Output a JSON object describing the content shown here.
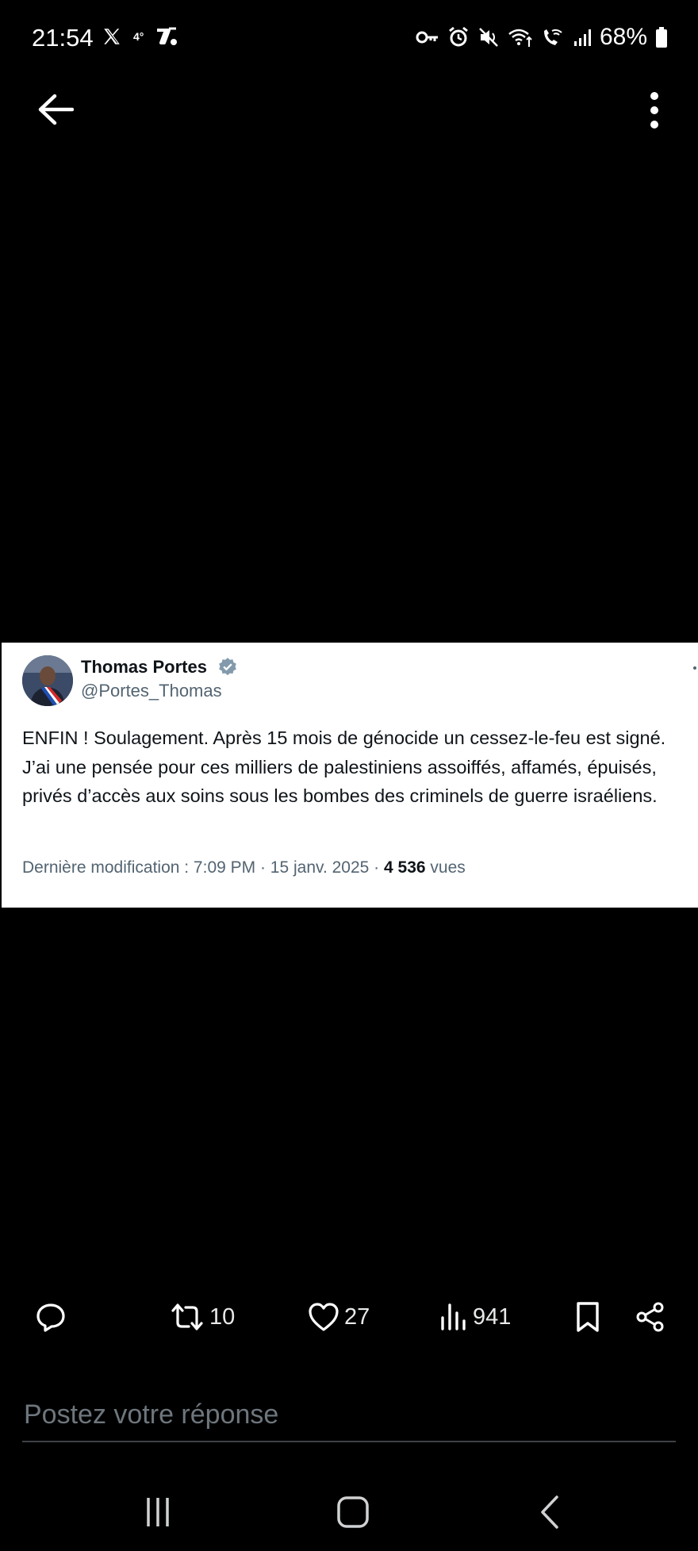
{
  "status_bar": {
    "time": "21:54",
    "temperature": "4°",
    "battery": "68%",
    "icons": [
      "x-logo-icon",
      "temperature-icon",
      "news-icon",
      "vpn-key-icon",
      "alarm-icon",
      "mute-icon",
      "wifi-icon",
      "wifi-calling-icon",
      "signal-icon",
      "battery-icon"
    ]
  },
  "top_bar": {
    "back_icon": "arrow-left-icon",
    "more_icon": "more-vertical-icon"
  },
  "tweet": {
    "author_name": "Thomas Portes",
    "author_handle": "@Portes_Thomas",
    "verified": true,
    "text": "ENFIN ! Soulagement. Après 15 mois de génocide un cessez-le-feu est signé. J’ai une pensée pour ces milliers de palestiniens assoiffés, affamés, épuisés, privés d’accès aux soins sous les bombes des criminels de guerre israéliens.",
    "meta_prefix": "Dernière modification : 7:09 PM · 15 janv. 2025 · ",
    "views_count": "4 536",
    "views_label": " vues"
  },
  "actions": {
    "reply_icon": "reply-icon",
    "retweet_count": "10",
    "like_count": "27",
    "views_count": "941",
    "bookmark_icon": "bookmark-icon",
    "share_icon": "share-icon"
  },
  "reply": {
    "placeholder": "Postez votre réponse"
  },
  "nav_bar": {
    "icons": [
      "recent-apps-icon",
      "home-icon",
      "back-icon"
    ]
  },
  "colors": {
    "background": "#000000",
    "card_background": "#ffffff",
    "verified": "#829aab",
    "secondary_text": "#536471"
  }
}
